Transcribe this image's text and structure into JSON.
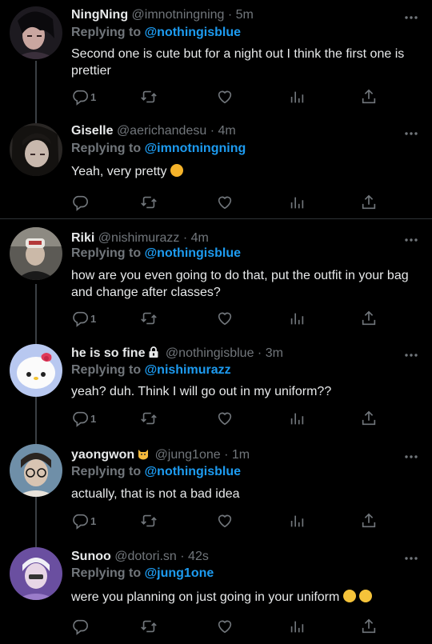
{
  "tweets": [
    {
      "name": "NingNing",
      "handle": "@imnotningning",
      "time": "5m",
      "replying_prefix": "Replying to",
      "replying_to": "@nothingisblue",
      "text": "Second one is cute but for a night out I think the first one is prettier",
      "reply_count": "1"
    },
    {
      "name": "Giselle",
      "handle": "@aerichandesu",
      "time": "4m",
      "replying_prefix": "Replying to",
      "replying_to": "@imnotningning",
      "text": "Yeah, very pretty",
      "reply_count": ""
    },
    {
      "name": "Riki",
      "handle": "@nishimurazz",
      "time": "4m",
      "replying_prefix": "Replying to",
      "replying_to": "@nothingisblue",
      "text": "how are you even going to do that, put the outfit in your bag and change after classes?",
      "reply_count": "1"
    },
    {
      "name": "he is so fine",
      "handle": "@nothingisblue",
      "time": "3m",
      "replying_prefix": "Replying to",
      "replying_to": "@nishimurazz",
      "text": "yeah? duh. Think I will go out in my uniform??",
      "reply_count": "1"
    },
    {
      "name": "yaongwon",
      "handle": "@jung1one",
      "time": "1m",
      "replying_prefix": "Replying to",
      "replying_to": "@nothingisblue",
      "text": "actually, that is not a bad idea",
      "reply_count": "1"
    },
    {
      "name": "Sunoo",
      "handle": "@dotori.sn",
      "time": "42s",
      "replying_prefix": "Replying to",
      "replying_to": "@jung1one",
      "text": "were you planning on just going in your uniform",
      "reply_count": ""
    }
  ],
  "colors": {
    "background": "#000000",
    "text": "#e7e9ea",
    "muted": "#71767b",
    "mention": "#1d9bf0",
    "divider": "#2f3336"
  },
  "icons": [
    "reply-icon",
    "retweet-icon",
    "like-icon",
    "analytics-icon",
    "share-icon",
    "more-icon",
    "lock-icon",
    "cat-emoji",
    "smiling-hearts-emoji",
    "grimacing-emoji"
  ]
}
